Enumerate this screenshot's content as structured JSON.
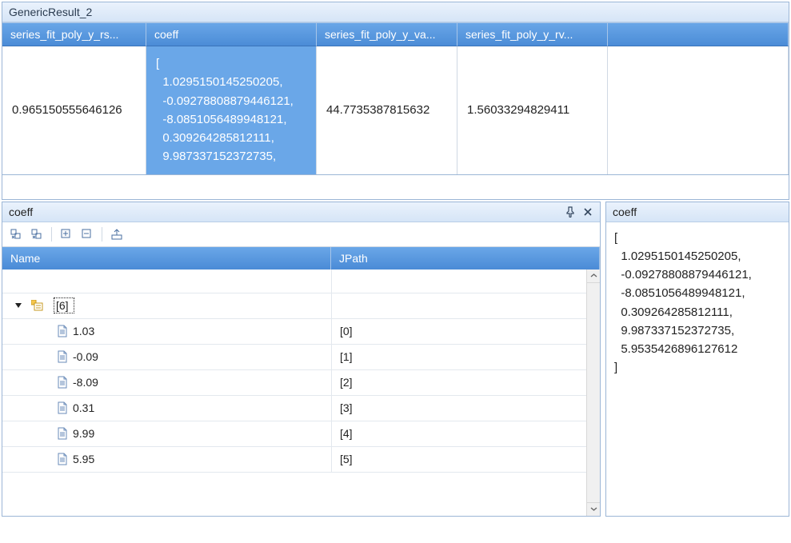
{
  "topPanel": {
    "title": "GenericResult_2",
    "columns": [
      "series_fit_poly_y_rs...",
      "coeff",
      "series_fit_poly_y_va...",
      "series_fit_poly_y_rv..."
    ],
    "row": {
      "c0": "0.965150555646126",
      "c1": "[\n  1.0295150145250205,\n  -0.09278808879446121,\n  -8.0851056489948121,\n  0.309264285812111,\n  9.987337152372735,",
      "c2": "44.7735387815632",
      "c3": "1.56033294829411"
    }
  },
  "leftPane": {
    "title": "coeff",
    "treeHeaders": {
      "name": "Name",
      "jpath": "JPath"
    },
    "root": "[6]",
    "items": [
      {
        "label": "1.03",
        "jpath": "[0]"
      },
      {
        "label": "-0.09",
        "jpath": "[1]"
      },
      {
        "label": "-8.09",
        "jpath": "[2]"
      },
      {
        "label": "0.31",
        "jpath": "[3]"
      },
      {
        "label": "9.99",
        "jpath": "[4]"
      },
      {
        "label": "5.95",
        "jpath": "[5]"
      }
    ]
  },
  "rightPane": {
    "title": "coeff",
    "text": "[\n  1.0295150145250205,\n  -0.09278808879446121,\n  -8.0851056489948121,\n  0.309264285812111,\n  9.987337152372735,\n  5.9535426896127612\n]"
  }
}
